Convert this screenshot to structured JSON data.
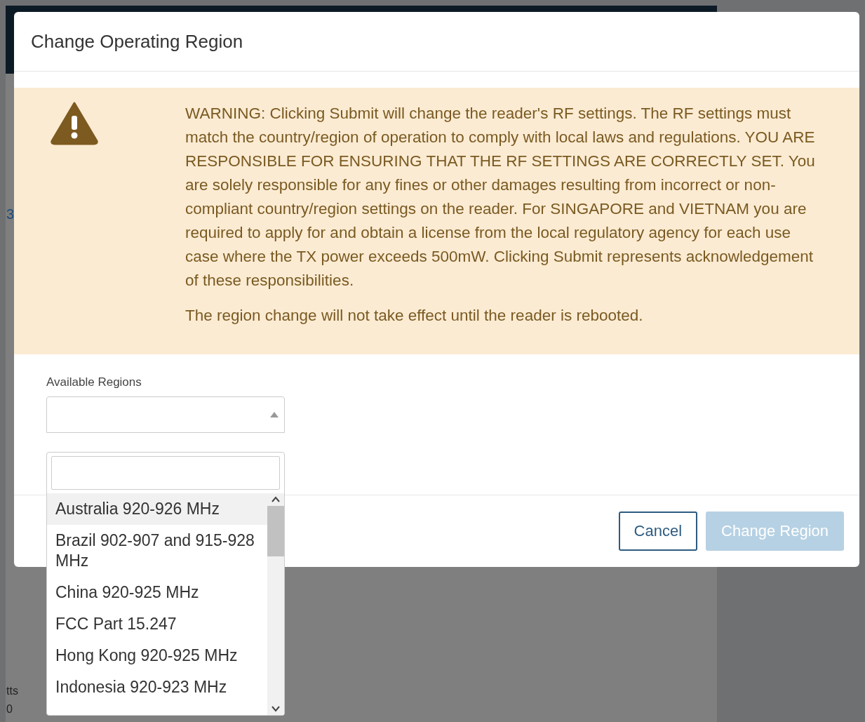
{
  "background": {
    "fragments": [
      "3",
      "tts",
      "0"
    ]
  },
  "dialog": {
    "title": "Change Operating Region",
    "warning": {
      "paragraphs": [
        "WARNING: Clicking Submit will change the reader's RF settings. The RF settings must match the country/region of operation to comply with local laws and regulations. YOU ARE RESPONSIBLE FOR ENSURING THAT THE RF SETTINGS ARE CORRECTLY SET. You are solely responsible for any fines or other damages resulting from incorrect or non-compliant country/region settings on the reader. For SINGAPORE and VIETNAM you are required to apply for and obtain a license from the local regulatory agency for each use case where the TX power exceeds 500mW. Clicking Submit represents acknowledgement of these responsibilities.",
        "The region change will not take effect until the reader is rebooted."
      ]
    },
    "region_select": {
      "label": "Available Regions",
      "expanded": true,
      "options": [
        {
          "label": "Australia 920-926 MHz",
          "selected": true
        },
        {
          "label": "Brazil 902-907 and 915-928 MHz",
          "selected": false
        },
        {
          "label": "China 920-925 MHz",
          "selected": false
        },
        {
          "label": "FCC Part 15.247",
          "selected": false
        },
        {
          "label": "Hong Kong 920-925 MHz",
          "selected": false
        },
        {
          "label": "Indonesia 920-923 MHz",
          "selected": false
        }
      ]
    },
    "buttons": [
      {
        "label": "Cancel",
        "kind": "secondary",
        "disabled": false
      },
      {
        "label": "Change Region",
        "kind": "primary",
        "disabled": true
      }
    ]
  }
}
